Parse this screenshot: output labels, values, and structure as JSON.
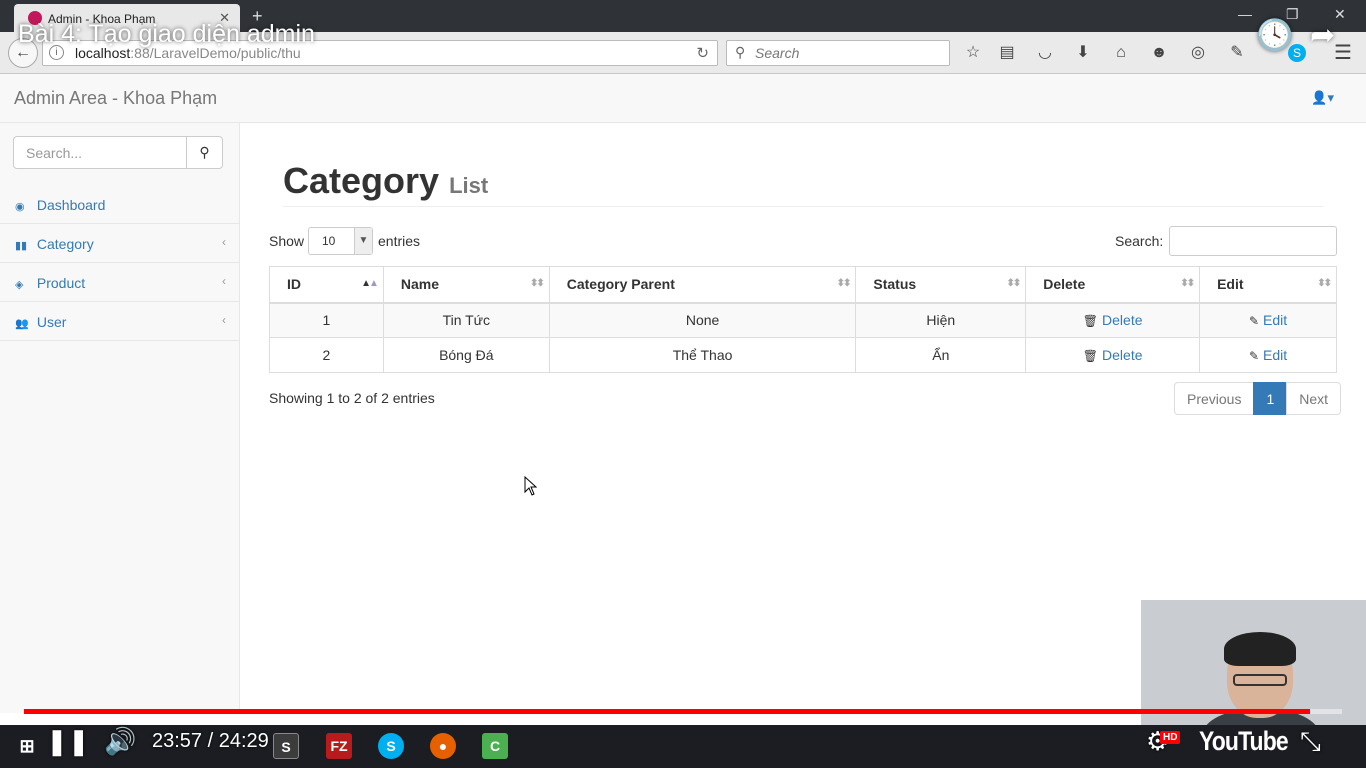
{
  "browser": {
    "tab_title": "Admin - Khoa Phạm",
    "url_host": "localhost",
    "url_rest": ":88/LaravelDemo/public/thu",
    "search_placeholder": "Search"
  },
  "video": {
    "title": "Bài 4: Tạo giao diện admin",
    "time_display": "23:57 / 24:29",
    "progress_fraction": 0.976,
    "logo": "YouTube",
    "hd_badge": "HD"
  },
  "header": {
    "brand": "Admin Area - Khoa Phạm"
  },
  "sidebar": {
    "search_placeholder": "Search...",
    "items": [
      {
        "label": "Dashboard",
        "icon": "dashboard-icon",
        "has_chevron": false
      },
      {
        "label": "Category",
        "icon": "bar-chart-icon",
        "has_chevron": true
      },
      {
        "label": "Product",
        "icon": "cube-icon",
        "has_chevron": true
      },
      {
        "label": "User",
        "icon": "users-icon",
        "has_chevron": true
      }
    ]
  },
  "main": {
    "title": "Category",
    "subtitle": "List",
    "show_label": "Show",
    "page_length": "10",
    "entries_label": "entries",
    "search_label": "Search:",
    "columns": [
      "ID",
      "Name",
      "Category Parent",
      "Status",
      "Delete",
      "Edit"
    ],
    "rows": [
      {
        "id": "1",
        "name": "Tin Tức",
        "parent": "None",
        "status": "Hiện",
        "delete": "Delete",
        "edit": "Edit"
      },
      {
        "id": "2",
        "name": "Bóng Đá",
        "parent": "Thể Thao",
        "status": "Ẩn",
        "delete": "Delete",
        "edit": "Edit"
      }
    ],
    "info": "Showing 1 to 2 of 2 entries",
    "pager": {
      "previous": "Previous",
      "current": "1",
      "next": "Next"
    }
  },
  "colors": {
    "link": "#337ab7",
    "progress": "#ff0000"
  }
}
